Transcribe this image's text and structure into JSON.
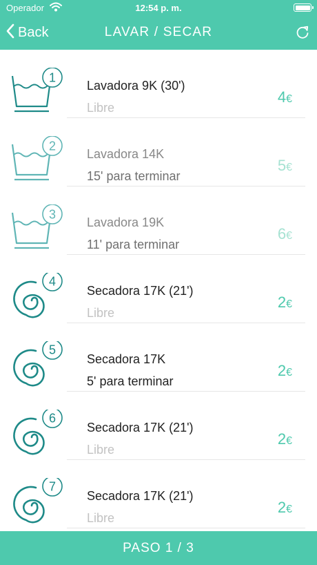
{
  "status_bar": {
    "carrier": "Operador",
    "time": "12:54 p. m.",
    "battery_level": 1.0
  },
  "nav": {
    "back_label": "Back",
    "title": "LAVAR / SECAR"
  },
  "colors": {
    "accent": "#4ec9ad",
    "washer_icon": "#1e8a88",
    "dryer_icon": "#1e8a88",
    "washer_icon_busy": "#5fb5b5"
  },
  "machines": [
    {
      "number": "1",
      "name": "Lavadora 9K (30')",
      "status": "Libre",
      "price": "4",
      "currency": "€",
      "kind": "washer",
      "available": true
    },
    {
      "number": "2",
      "name": "Lavadora 14K",
      "status": "15' para terminar",
      "price": "5",
      "currency": "€",
      "kind": "washer",
      "available": false
    },
    {
      "number": "3",
      "name": "Lavadora 19K",
      "status": "11' para terminar",
      "price": "6",
      "currency": "€",
      "kind": "washer",
      "available": false
    },
    {
      "number": "4",
      "name": "Secadora 17K (21')",
      "status": "Libre",
      "price": "2",
      "currency": "€",
      "kind": "dryer",
      "available": true
    },
    {
      "number": "5",
      "name": "Secadora 17K",
      "status": "5' para terminar",
      "price": "2",
      "currency": "€",
      "kind": "dryer",
      "available": false
    },
    {
      "number": "6",
      "name": "Secadora 17K (21')",
      "status": "Libre",
      "price": "2",
      "currency": "€",
      "kind": "dryer",
      "available": true
    },
    {
      "number": "7",
      "name": "Secadora 17K (21')",
      "status": "Libre",
      "price": "2",
      "currency": "€",
      "kind": "dryer",
      "available": true
    }
  ],
  "footer": {
    "step_label": "PASO 1 / 3"
  }
}
